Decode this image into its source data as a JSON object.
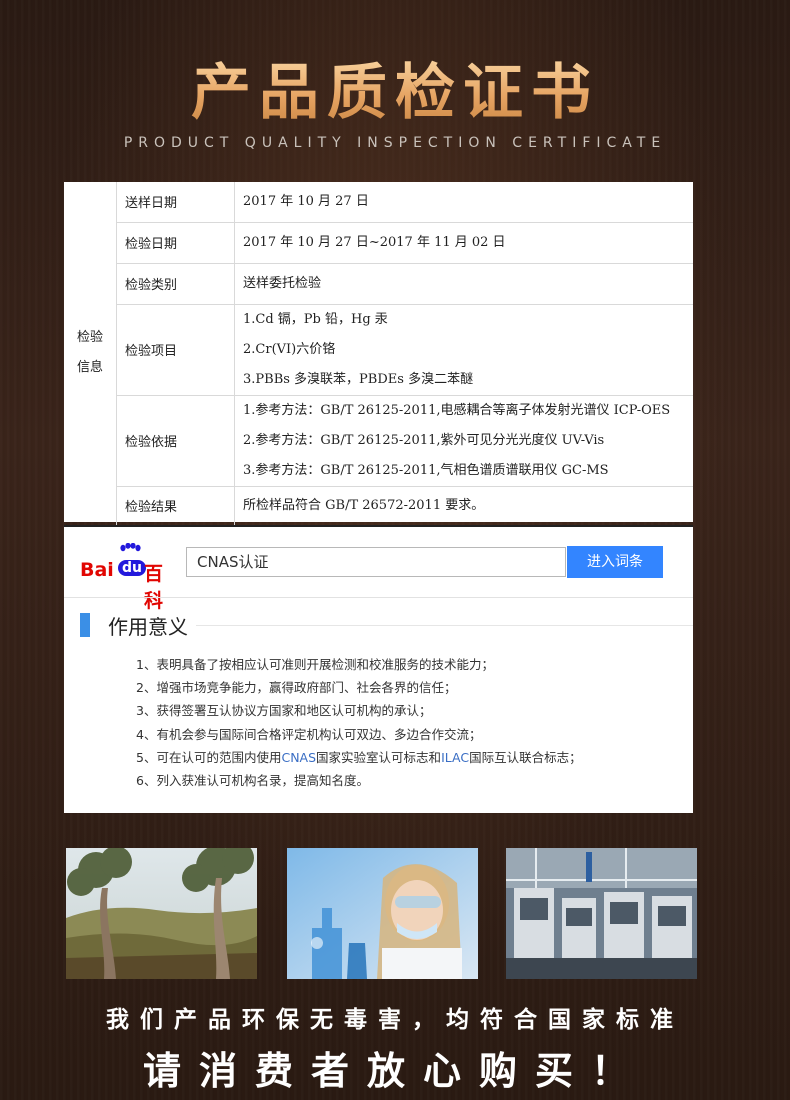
{
  "header": {
    "title": "产品质检证书",
    "subtitle": "PRODUCT QUALITY INSPECTION CERTIFICATE"
  },
  "certificate": {
    "group_label": "检验信息",
    "group_label_line1": "检验",
    "group_label_line2": "信息",
    "rows": [
      {
        "label": "送样日期",
        "values": [
          "2017 年 10 月 27 日"
        ]
      },
      {
        "label": "检验日期",
        "values": [
          "2017 年 10 月 27 日~2017 年 11 月 02 日"
        ]
      },
      {
        "label": "检验类别",
        "values": [
          "送样委托检验"
        ]
      },
      {
        "label": "检验项目",
        "values": [
          "1.Cd 镉，Pb 铅，Hg 汞",
          "2.Cr(VI)六价铬",
          "3.PBBs 多溴联苯，PBDEs 多溴二苯醚"
        ]
      },
      {
        "label": "检验依据",
        "values": [
          "1.参考方法：GB/T 26125-2011,电感耦合等离子体发射光谱仪 ICP-OES",
          "2.参考方法：GB/T 26125-2011,紫外可见分光光度仪 UV-Vis",
          "3.参考方法：GB/T 26125-2011,气相色谱质谱联用仪 GC-MS"
        ]
      },
      {
        "label": "检验结果",
        "values": [
          "所检样品符合 GB/T 26572-2011 要求。"
        ]
      }
    ]
  },
  "baidu": {
    "logo_bai": "Bai",
    "logo_du": "du",
    "logo_ke": "百科",
    "search_value": "CNAS认证",
    "search_button": "进入词条",
    "section_title": "作用意义",
    "items": [
      "1、表明具备了按相应认可准则开展检测和校准服务的技术能力；",
      "2、增强市场竞争能力，赢得政府部门、社会各界的信任；",
      "3、获得签署互认协议方国家和地区认可机构的承认；",
      "4、有机会参与国际间合格评定机构认可双边、多边合作交流；",
      "6、列入获准认可机构名录，提高知名度。"
    ],
    "item5_prefix": "5、可在认可的范围内使用",
    "item5_link1": "CNAS",
    "item5_mid": "国家实验室认可标志和",
    "item5_link2": "ILAC",
    "item5_suffix": "国际互认联合标志；"
  },
  "slogan": {
    "line1": "我们产品环保无毒害，均符合国家标准",
    "line2": "请消费者放心购买！"
  },
  "colors": {
    "title_gold": "#e6a463",
    "baidu_red": "#e10602",
    "baidu_blue": "#2319dc",
    "button_blue": "#3385ff",
    "section_mark": "#3b8fe6",
    "link_blue": "#3a6ec4"
  },
  "icons": {
    "baidu_paw": "paw-icon"
  }
}
